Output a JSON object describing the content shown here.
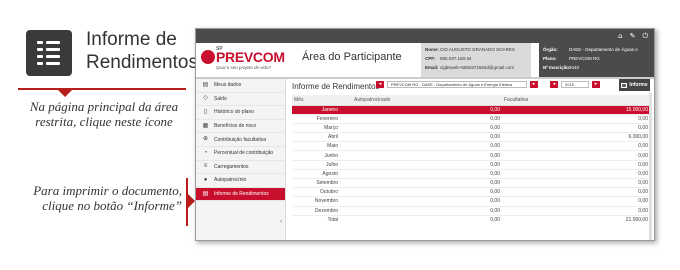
{
  "left_panel": {
    "icon": "document-lines-icon",
    "title_line1": "Informe de",
    "title_line2": "Rendimentos",
    "note1": "Na página principal da área restrita, clique neste ícone",
    "note2": "Para imprimir o documento, clique no botão “Informe”"
  },
  "topbar": {
    "icons": [
      "home-icon",
      "wrench-icon",
      "logout-icon"
    ],
    "glyphs": [
      "⌂",
      "✎",
      "⏻"
    ]
  },
  "header": {
    "logo_prefix": "SP",
    "logo_brand": "PREVCOM",
    "logo_tagline": "Qual o seu projeto de vida?",
    "area_title": "Área do Participante",
    "user": {
      "rows": [
        {
          "key": "Nome:",
          "value": "CID AUGUSTO GRANADO SOARES"
        },
        {
          "key": "CPF:",
          "value": "555.037.158-34"
        },
        {
          "key": "Email:",
          "value": "cigbsweb+5550371583d@gmail.com"
        }
      ]
    },
    "org": {
      "rows": [
        {
          "key": "Órgão:",
          "value": "DAEE - Departamento de Águas e"
        },
        {
          "key": "Plano:",
          "value": "PREVCOM RG"
        },
        {
          "key": "Nº Inscrição:",
          "value": "3440"
        }
      ]
    }
  },
  "sidebar": {
    "items": [
      {
        "label": "Meus dados",
        "icon": "id-card-icon",
        "glyph": "▤",
        "active": false
      },
      {
        "label": "Saldo",
        "icon": "tag-icon",
        "glyph": "◇",
        "active": false
      },
      {
        "label": "Histórico do plano",
        "icon": "document-icon",
        "glyph": "▯",
        "active": false
      },
      {
        "label": "Benefícios de risco",
        "icon": "grid-icon",
        "glyph": "▦",
        "active": false
      },
      {
        "label": "Contribuição facultativa",
        "icon": "plus-circle-icon",
        "glyph": "⊕",
        "active": false
      },
      {
        "label": "Percentual de contribuição",
        "icon": "pie-chart-icon",
        "glyph": "◔",
        "active": false
      },
      {
        "label": "Carregamentos",
        "icon": "coins-icon",
        "glyph": "≡",
        "active": false
      },
      {
        "label": "Autopatrocínio",
        "icon": "person-icon",
        "glyph": "●",
        "active": false
      },
      {
        "label": "Informe de Rendimentos",
        "icon": "document-lines-icon",
        "glyph": "▤",
        "active": true
      }
    ],
    "toggle": "‹"
  },
  "main": {
    "title": "Informe de Rendimentos",
    "plan_select": "PREVCOM RG - DAEE - Departamento de Águas e Energia Elétrica",
    "plan_prev": "◂",
    "plan_next": "▸",
    "year_prev": "◂",
    "year_select": "2015",
    "year_next": "▸",
    "informe_button": "Informe",
    "columns": [
      "Mês",
      "Autopatrocinado",
      "Facultativa"
    ],
    "rows": [
      {
        "mes": "Janeiro",
        "auto": "0,00",
        "fac": "15.000,00",
        "highlight": true
      },
      {
        "mes": "Fevereiro",
        "auto": "0,00",
        "fac": "0,00"
      },
      {
        "mes": "Março",
        "auto": "0,00",
        "fac": "0,00"
      },
      {
        "mes": "Abril",
        "auto": "0,00",
        "fac": "6.000,00"
      },
      {
        "mes": "Maio",
        "auto": "0,00",
        "fac": "0,00"
      },
      {
        "mes": "Junho",
        "auto": "0,00",
        "fac": "0,00"
      },
      {
        "mes": "Julho",
        "auto": "0,00",
        "fac": "0,00"
      },
      {
        "mes": "Agosto",
        "auto": "0,00",
        "fac": "0,00"
      },
      {
        "mes": "Setembro",
        "auto": "0,00",
        "fac": "0,00"
      },
      {
        "mes": "Outubro",
        "auto": "0,00",
        "fac": "0,00"
      },
      {
        "mes": "Novembro",
        "auto": "0,00",
        "fac": "0,00"
      },
      {
        "mes": "Dezembro",
        "auto": "0,00",
        "fac": "0,00"
      },
      {
        "mes": "Total",
        "auto": "0,00",
        "fac": "21.000,00",
        "total": true
      }
    ]
  },
  "colors": {
    "accent": "#c8102e",
    "dark": "#4b4b4b",
    "pointer": "#b81d1d"
  }
}
